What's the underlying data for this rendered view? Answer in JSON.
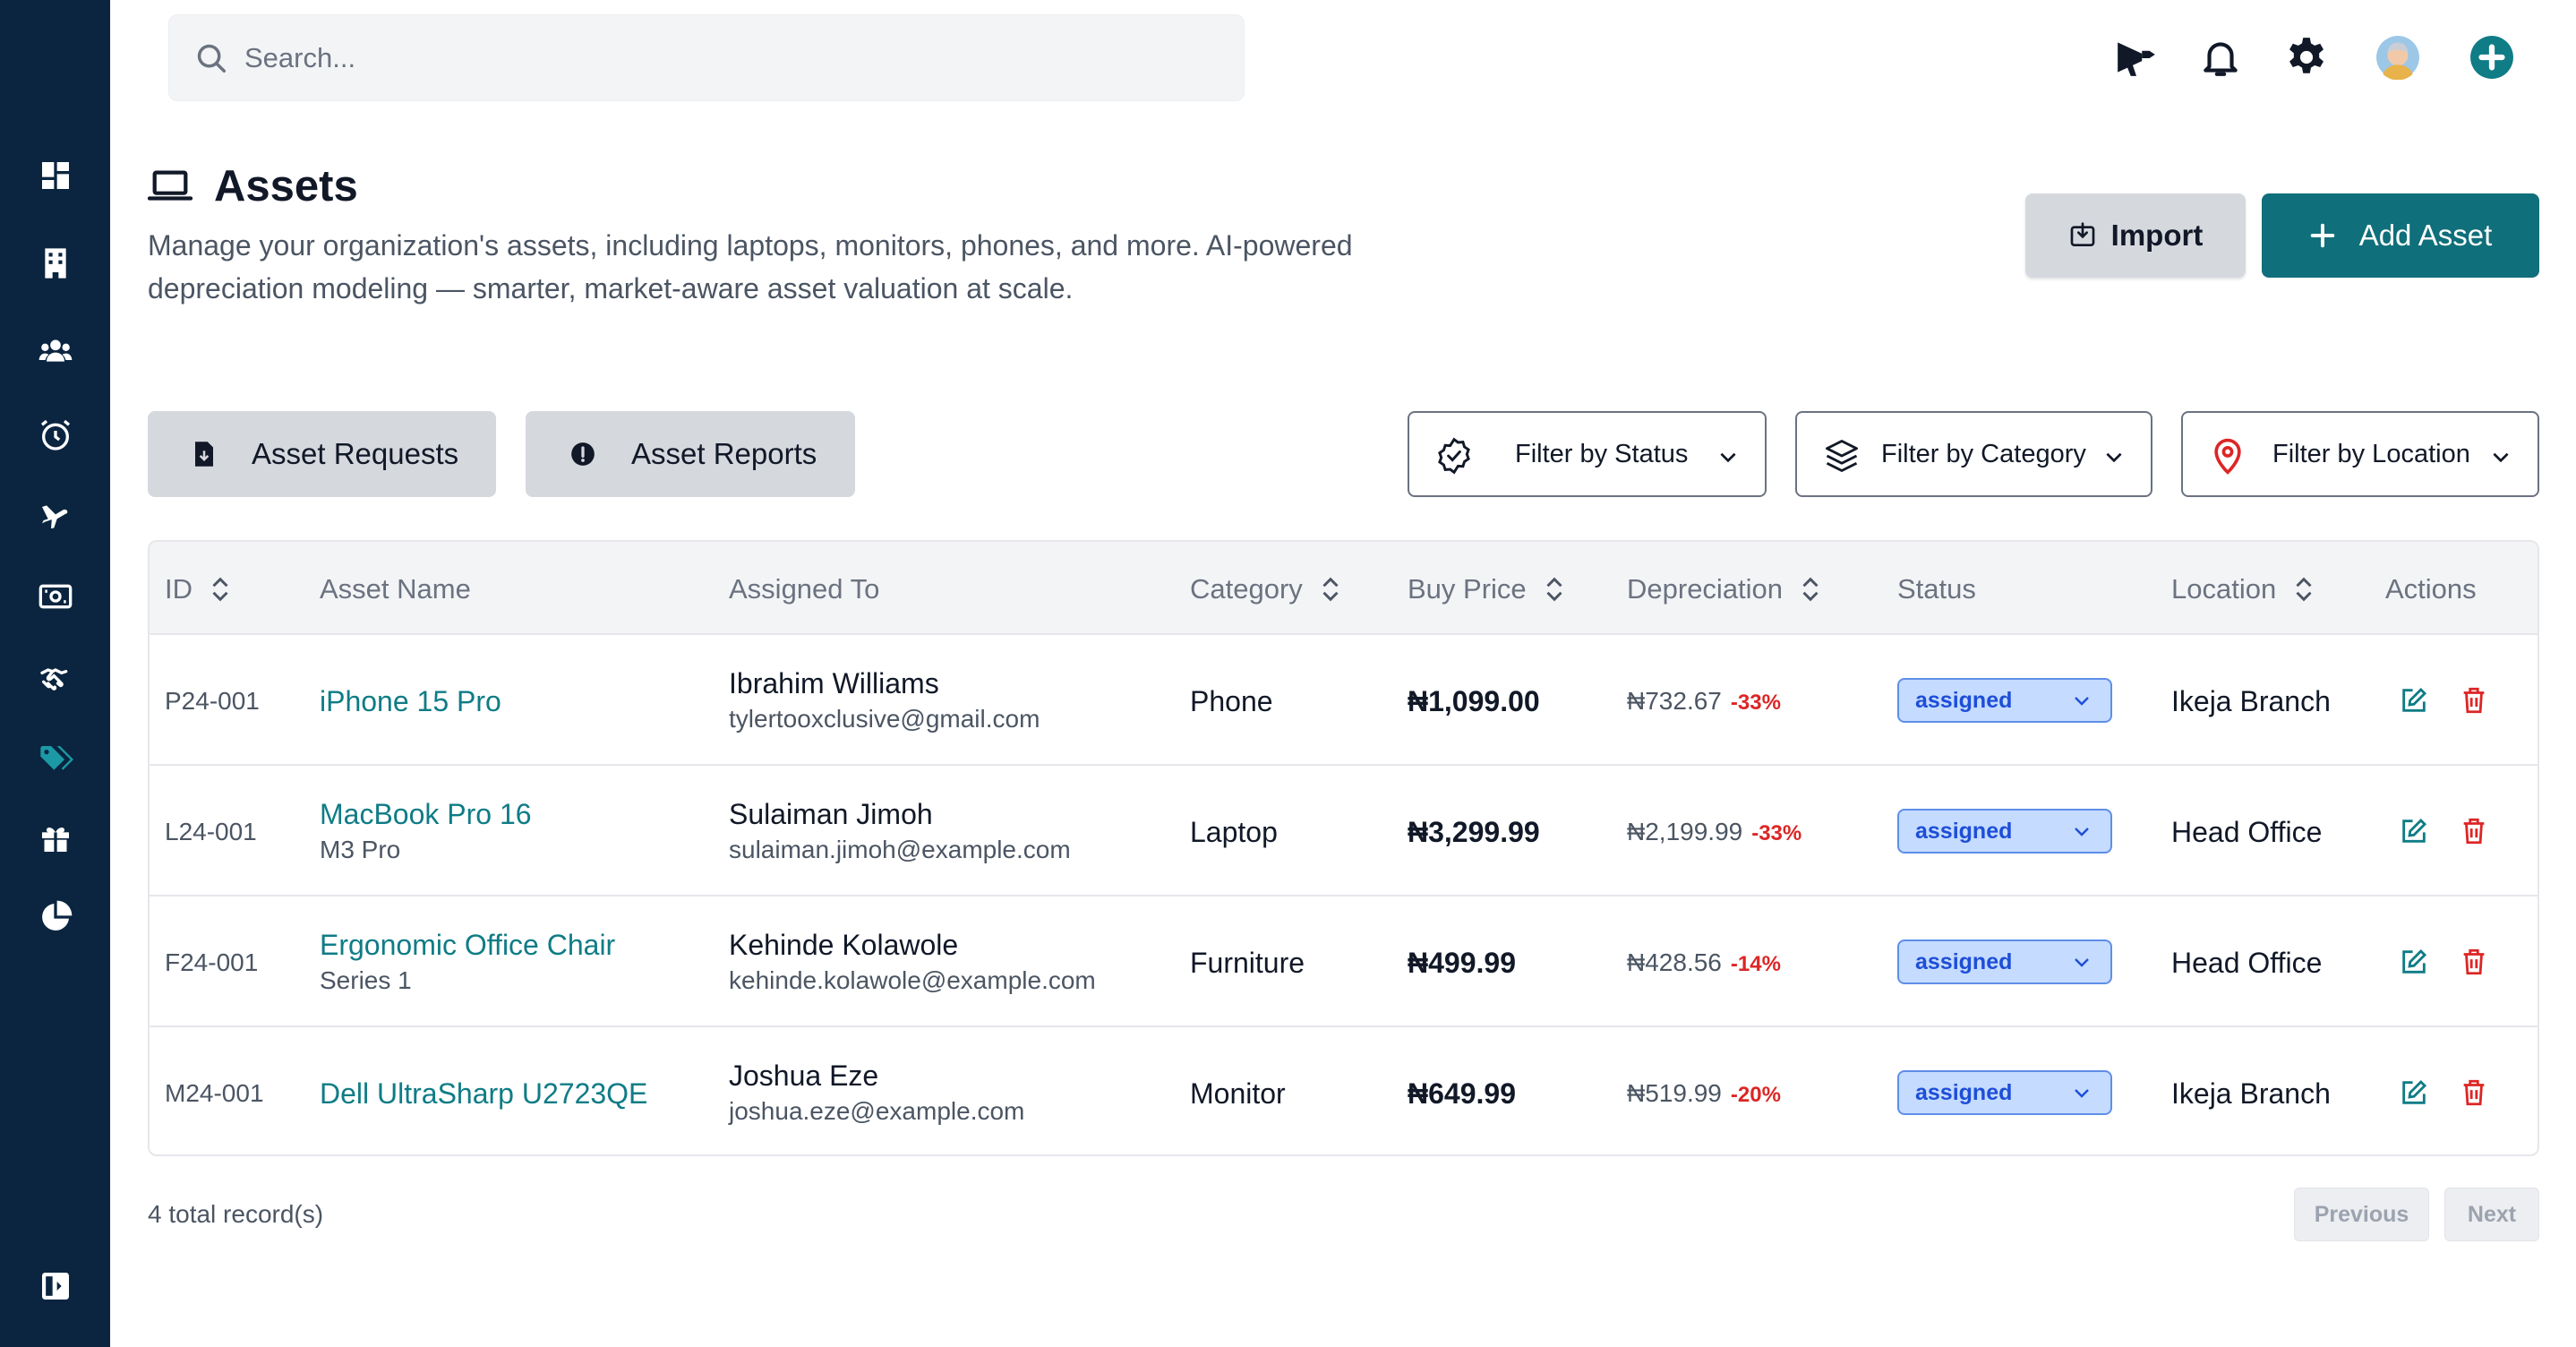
{
  "search": {
    "placeholder": "Search..."
  },
  "header": {
    "title": "Assets",
    "description": "Manage your organization's assets, including laptops, monitors, phones, and more. AI-powered depreciation modeling — smarter, market-aware asset valuation at scale.",
    "import_label": "Import",
    "add_label": "Add Asset"
  },
  "sub_actions": {
    "requests_label": "Asset Requests",
    "reports_label": "Asset Reports"
  },
  "filters": {
    "status": "Filter by Status",
    "category": "Filter by Category",
    "location": "Filter by Location"
  },
  "table": {
    "columns": [
      "ID",
      "Asset Name",
      "Assigned To",
      "Category",
      "Buy Price",
      "Depreciation",
      "Status",
      "Location",
      "Actions"
    ],
    "rows": [
      {
        "id": "P24-001",
        "name": "iPhone 15 Pro",
        "subname": "",
        "person": "Ibrahim Williams",
        "email": "tylertooxclusive@gmail.com",
        "category": "Phone",
        "price": "₦1,099.00",
        "depreciation": "₦732.67",
        "dep_pct": "-33%",
        "status": "assigned",
        "location": "Ikeja Branch"
      },
      {
        "id": "L24-001",
        "name": "MacBook Pro 16",
        "subname": "M3 Pro",
        "person": "Sulaiman Jimoh",
        "email": "sulaiman.jimoh@example.com",
        "category": "Laptop",
        "price": "₦3,299.99",
        "depreciation": "₦2,199.99",
        "dep_pct": "-33%",
        "status": "assigned",
        "location": "Head Office"
      },
      {
        "id": "F24-001",
        "name": "Ergonomic Office Chair",
        "subname": "Series 1",
        "person": "Kehinde Kolawole",
        "email": "kehinde.kolawole@example.com",
        "category": "Furniture",
        "price": "₦499.99",
        "depreciation": "₦428.56",
        "dep_pct": "-14%",
        "status": "assigned",
        "location": "Head Office"
      },
      {
        "id": "M24-001",
        "name": "Dell UltraSharp U2723QE",
        "subname": "",
        "person": "Joshua Eze",
        "email": "joshua.eze@example.com",
        "category": "Monitor",
        "price": "₦649.99",
        "depreciation": "₦519.99",
        "dep_pct": "-20%",
        "status": "assigned",
        "location": "Ikeja Branch"
      }
    ]
  },
  "footer": {
    "records": "4 total record(s)",
    "previous": "Previous",
    "next": "Next"
  },
  "colors": {
    "sidebar": "#0b2540",
    "accent": "#0f6f7a",
    "link": "#0f7c86",
    "danger": "#dc2626",
    "status_bg": "#c5dbff"
  },
  "sidebar_icons": [
    "dashboard-icon",
    "building-icon",
    "users-icon",
    "alarm-clock-icon",
    "plane-icon",
    "money-icon",
    "handshake-icon",
    "tags-icon",
    "gift-icon",
    "pie-chart-icon",
    "sidebar-toggle-icon"
  ]
}
